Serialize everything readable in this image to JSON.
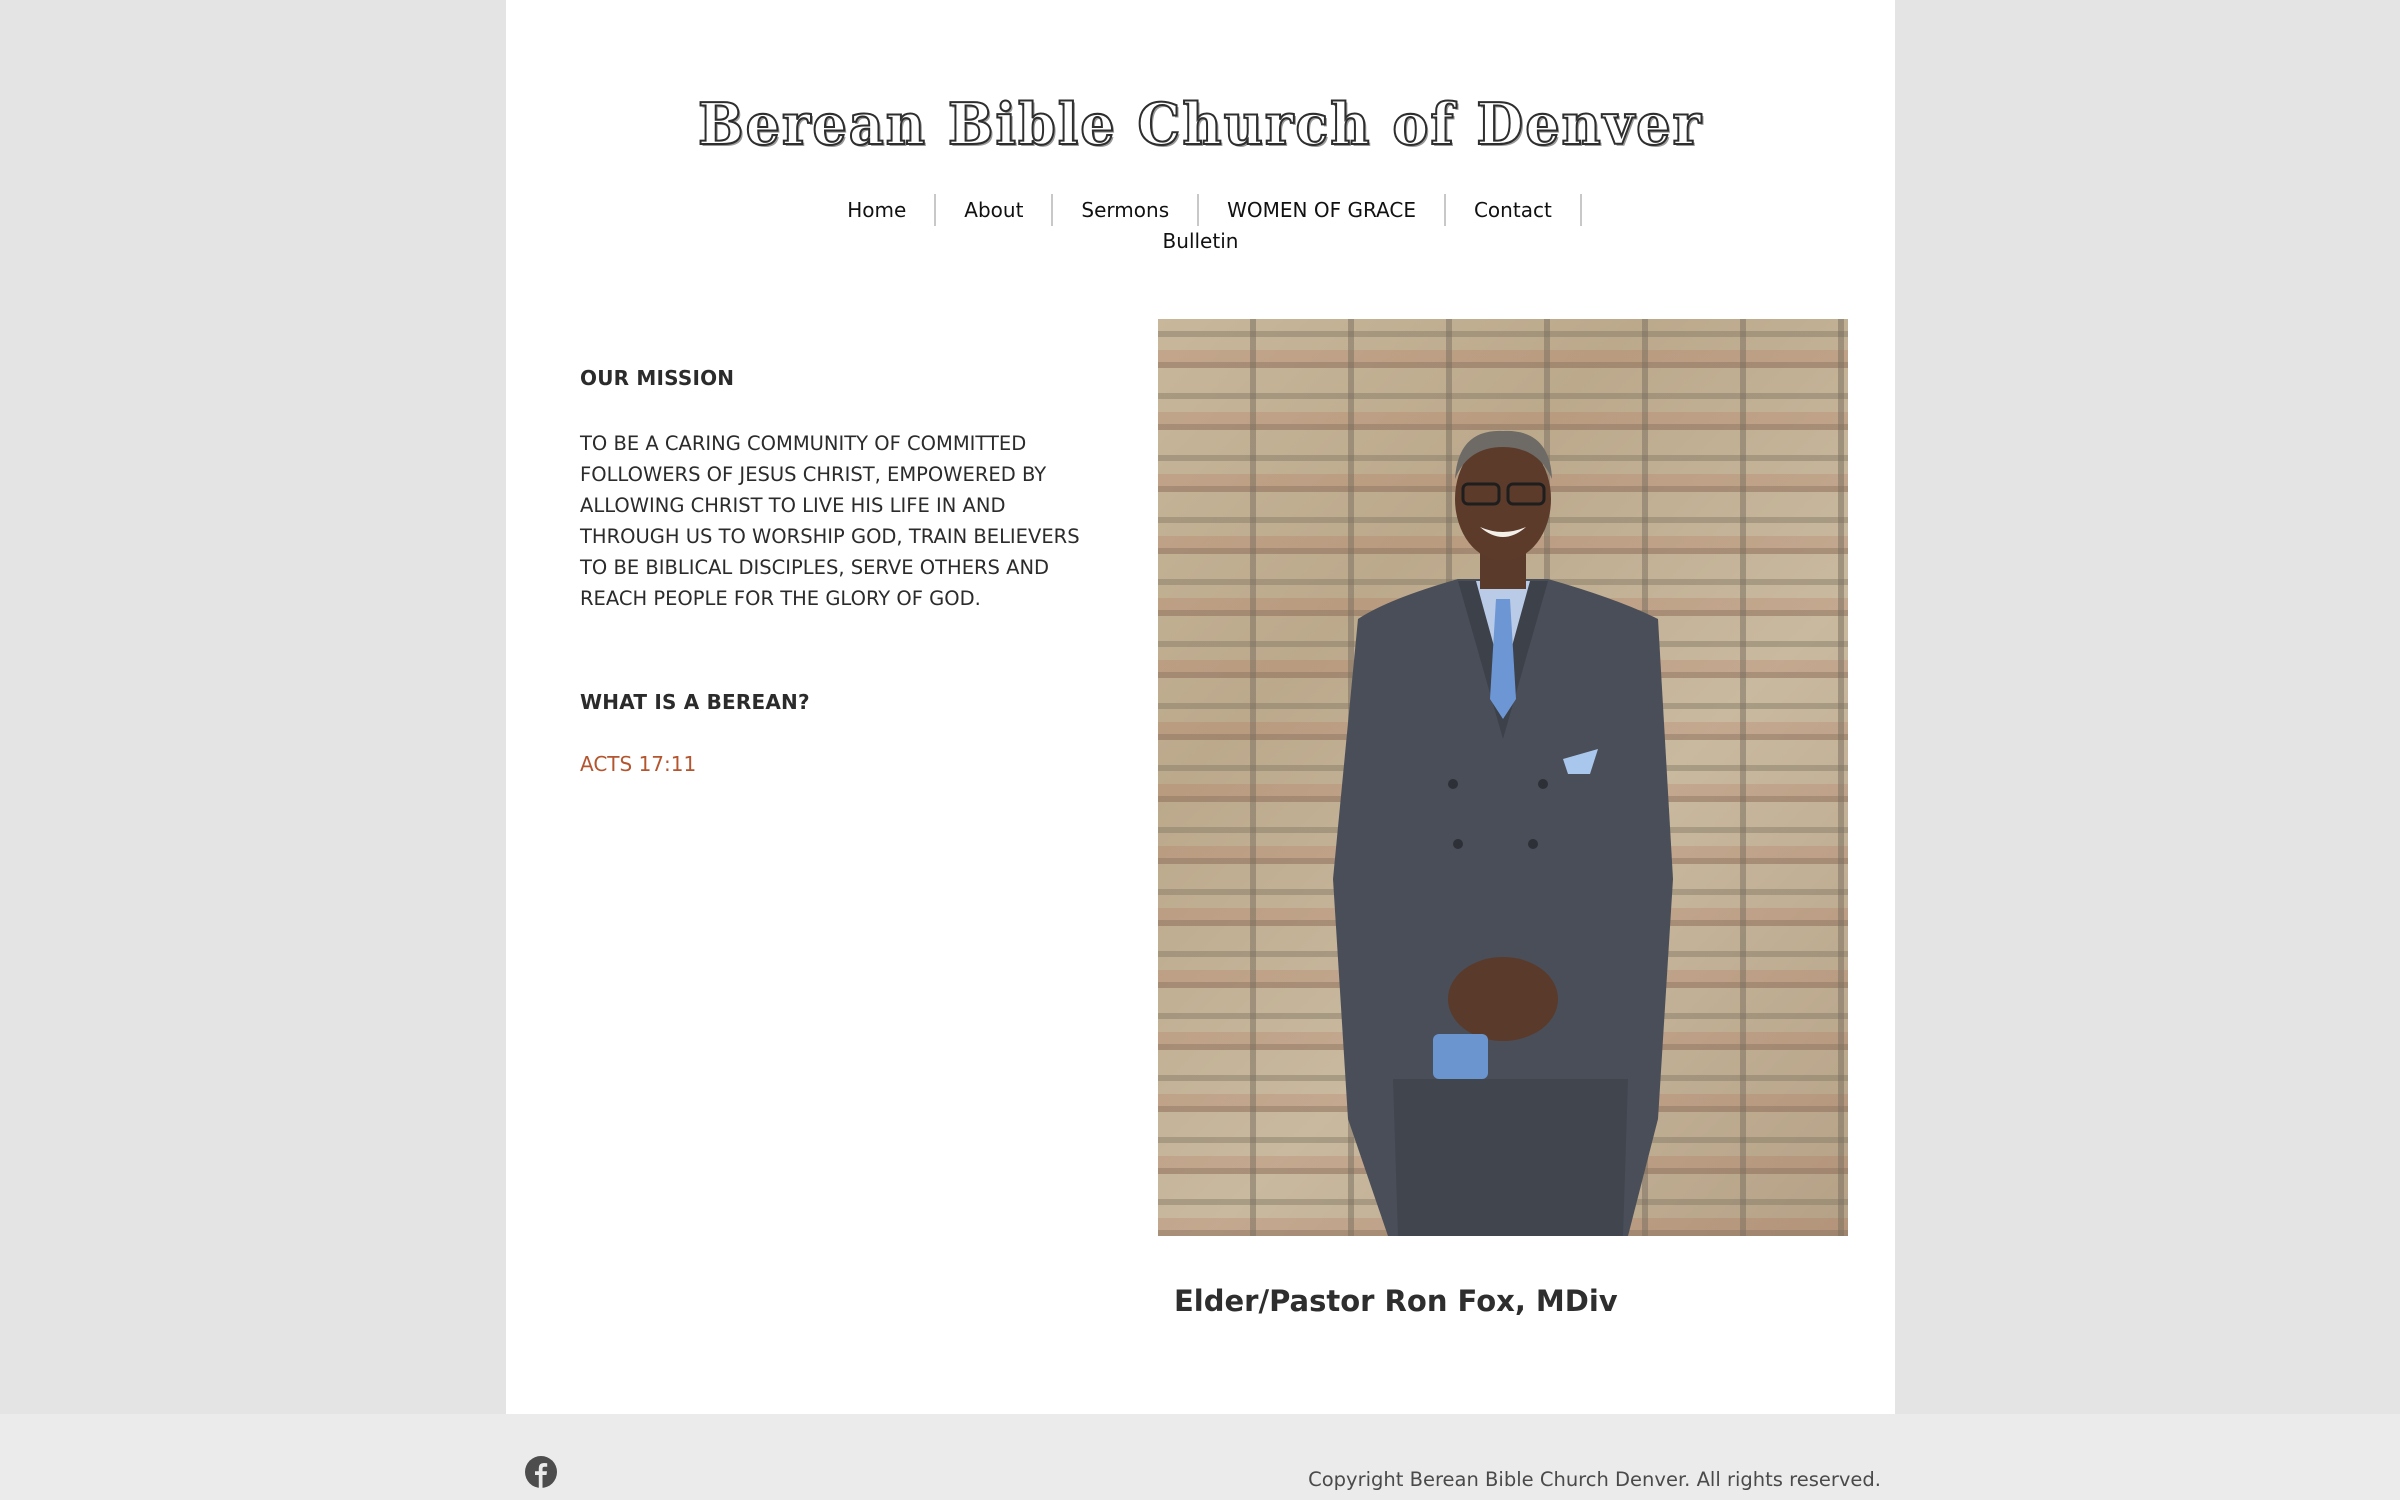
{
  "site": {
    "title": "Berean Bible Church of Denver"
  },
  "nav": {
    "items": [
      {
        "label": "Home"
      },
      {
        "label": "About"
      },
      {
        "label": "Sermons"
      },
      {
        "label": "WOMEN OF GRACE"
      },
      {
        "label": "Contact"
      },
      {
        "label": "Bulletin"
      }
    ]
  },
  "main": {
    "mission_heading": "OUR MISSION",
    "mission_text": "TO BE A CARING COMMUNITY OF COMMITTED FOLLOWERS OF JESUS CHRIST, EMPOWERED BY ALLOWING CHRIST TO LIVE HIS LIFE IN AND THROUGH US TO WORSHIP GOD, TRAIN BELIEVERS TO BE BIBLICAL DISCIPLES, SERVE OTHERS AND REACH PEOPLE FOR THE GLORY OF GOD.",
    "berean_heading": "WHAT IS A BEREAN?",
    "berean_link": "ACTS 17:11",
    "photo_alt": "Pastor standing in a grey double-breasted suit in front of a brick wall",
    "photo_caption": "Elder/Pastor Ron Fox, MDiv"
  },
  "footer": {
    "social_icon": "facebook-icon",
    "copyright": "Copyright Berean Bible Church Denver. All rights reserved."
  },
  "colors": {
    "link_accent": "#b4552f",
    "page_bg": "#e4e4e4",
    "footer_bg": "#ebebeb"
  }
}
